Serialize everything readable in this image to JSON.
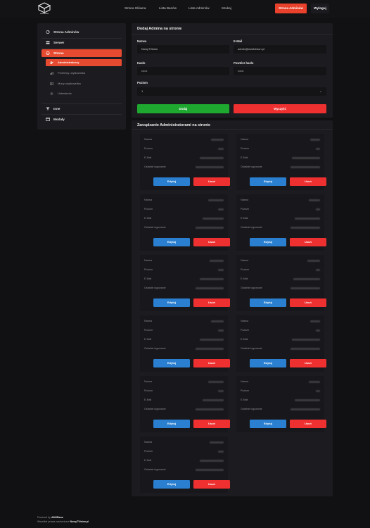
{
  "header": {
    "nav": [
      "Strona Główna",
      "Lista Banów",
      "Lista Adminów",
      "Szukaj"
    ],
    "admin_button": "Strona Adminów",
    "logout_button": "Wyloguj"
  },
  "sidebar": {
    "items": [
      {
        "label": "Strona Adminów",
        "icon": "dashboard-icon"
      },
      {
        "label": "Serwer",
        "icon": "server-icon"
      },
      {
        "label": "Strona",
        "icon": "globe-icon"
      },
      {
        "label": "Inne",
        "icon": "filter-icon"
      },
      {
        "label": "Modały",
        "icon": "window-icon"
      }
    ],
    "subitems": [
      {
        "label": "Administratorzy",
        "icon": "users-icon"
      },
      {
        "label": "Przelewy użytkownika",
        "icon": "chart-icon"
      },
      {
        "label": "Mony użytkownika",
        "icon": "money-icon"
      },
      {
        "label": "Ustawienia",
        "icon": "gear-icon"
      }
    ]
  },
  "form": {
    "title": "Dodaj Admina na stronie",
    "name_label": "Nazwa",
    "name_value": "NowyTVision",
    "email_label": "E-Mail",
    "email_value": "admin@nowtvision.pl",
    "password_label": "Hasło",
    "password_value": "••••••",
    "password2_label": "Powtórz hasło",
    "password2_value": "••••••",
    "level_label": "Poziom",
    "level_value": "1",
    "add_button": "Dodaj",
    "clear_button": "Wyczyść"
  },
  "admins": {
    "title": "Zarządzanie Administratorami na stronie",
    "field_labels": [
      "Nazwa",
      "Poziom",
      "E-Mail",
      "Ostatnie logowanie"
    ],
    "edit_label": "Edytuj",
    "delete_label": "Usuń",
    "count": 11
  },
  "footer": {
    "powered_prefix": "Powered by",
    "powered_name": "AMXBans",
    "rights_prefix": "Wszelkie prawa zastrzeżone",
    "rights_name": "NowyTVision.pl"
  },
  "colors": {
    "accent": "#e64a30",
    "green": "#1fa82f",
    "red": "#ef3030",
    "blue": "#2a7fd0"
  }
}
